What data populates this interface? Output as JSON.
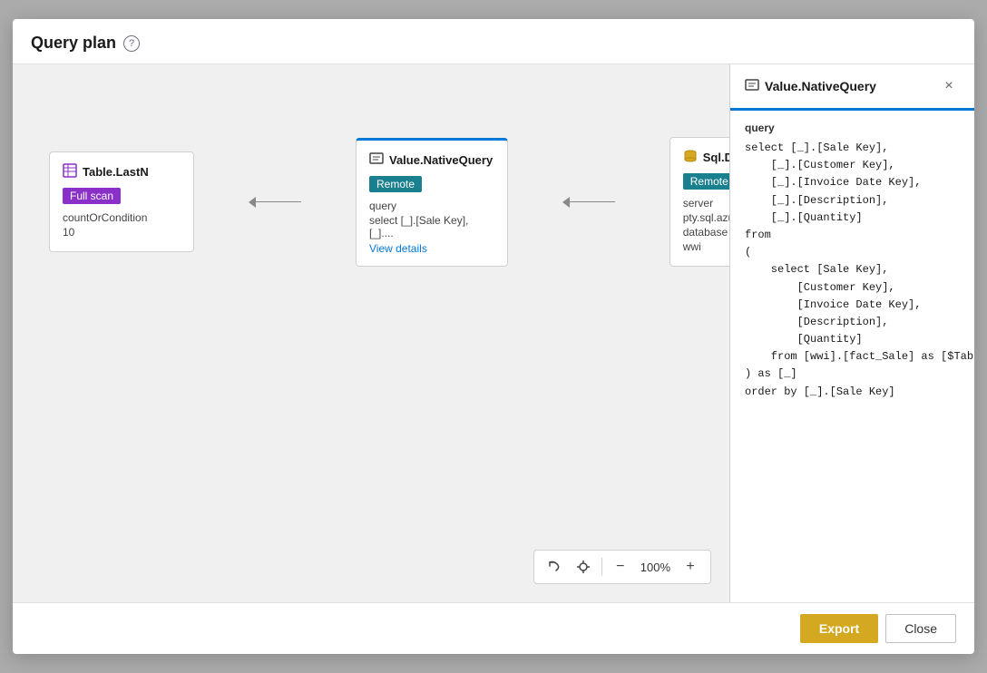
{
  "modal": {
    "title": "Query plan",
    "help_icon_label": "?",
    "footer": {
      "export_label": "Export",
      "close_label": "Close"
    }
  },
  "diagram": {
    "nodes": [
      {
        "id": "table-lastn",
        "icon": "table-icon",
        "title": "Table.LastN",
        "badge": "Full scan",
        "badge_type": "purple",
        "props": [
          {
            "key": "countOrCondition",
            "value": ""
          },
          {
            "key": "10",
            "value": ""
          }
        ]
      },
      {
        "id": "value-nativequery",
        "icon": "query-icon",
        "title": "Value.NativeQuery",
        "badge": "Remote",
        "badge_type": "teal",
        "props": [
          {
            "key": "query",
            "value": ""
          },
          {
            "key": "select [_].[Sale Key], [_]....",
            "value": ""
          }
        ],
        "link": "View details"
      },
      {
        "id": "sql-database",
        "icon": "database-icon",
        "title": "Sql.Database",
        "badge": "Remote",
        "badge_type": "teal",
        "props": [
          {
            "key": "server",
            "value": ""
          },
          {
            "key": "pty.sql.azuresynapse.net",
            "value": ""
          },
          {
            "key": "database",
            "value": ""
          },
          {
            "key": "wwi",
            "value": ""
          }
        ]
      }
    ],
    "toolbar": {
      "zoom": "100%",
      "zoom_in": "+",
      "zoom_out": "−"
    }
  },
  "detail_panel": {
    "title": "Value.NativeQuery",
    "icon": "query-panel-icon",
    "section_label": "query",
    "code_lines": [
      "select [_].[Sale Key],",
      "    [_].[Customer Key],",
      "    [_].[Invoice Date Key],",
      "    [_].[Description],",
      "    [_].[Quantity]",
      "from",
      "(",
      "    select [Sale Key],",
      "        [Customer Key],",
      "        [Invoice Date Key],",
      "        [Description],",
      "        [Quantity]",
      "    from [wwi].[fact_Sale] as [$Table]",
      ") as [_]",
      "order by [_].[Sale Key]"
    ]
  }
}
